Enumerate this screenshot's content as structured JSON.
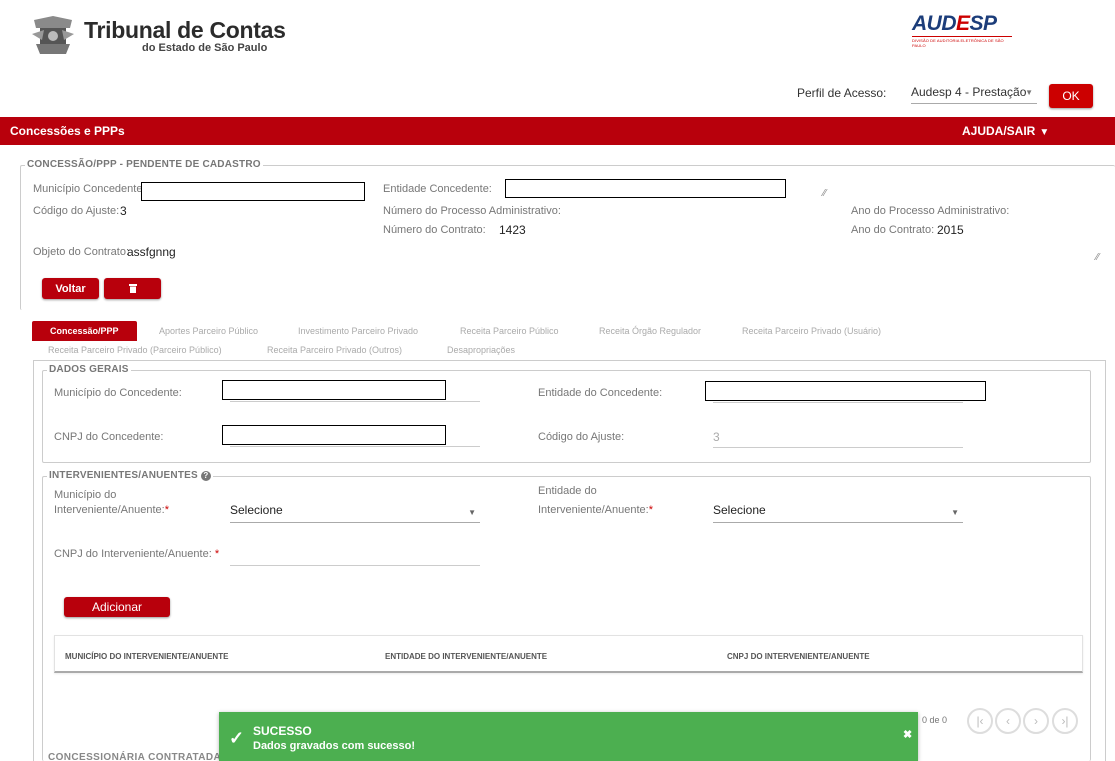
{
  "header": {
    "logo_title": "Tribunal de Contas",
    "logo_subtitle": "do Estado de São Paulo",
    "audesp_title_a": "AUD",
    "audesp_title_e": "E",
    "audesp_title_b": "SP",
    "audesp_subtitle": "DIVISÃO DE AUDITORIA ELETRÔNICA DE SÃO PAULO",
    "perfil_label": "Perfil de Acesso:",
    "perfil_value": "Audesp 4 - Prestação",
    "ok_label": "OK"
  },
  "navbar": {
    "title": "Concessões e PPPs",
    "help": "AJUDA/SAIR"
  },
  "pending": {
    "legend": "CONCESSÃO/PPP - PENDENTE DE CADASTRO",
    "municipio_label": "Município Concedente:",
    "entidade_label": "Entidade Concedente:",
    "codigo_label": "Código do Ajuste:",
    "codigo_value": "3",
    "num_processo_label": "Número do Processo Administrativo:",
    "ano_processo_label": "Ano do Processo Administrativo:",
    "num_contrato_label": "Número do Contrato:",
    "num_contrato_value": "1423",
    "ano_contrato_label": "Ano do Contrato:",
    "ano_contrato_value": "2015",
    "objeto_label": "Objeto do Contrato:",
    "objeto_value": "assfgnng",
    "voltar_label": "Voltar",
    "delete_icon": "trash-icon"
  },
  "tabs": [
    "Concessão/PPP",
    "Aportes Parceiro Público",
    "Investimento Parceiro Privado",
    "Receita Parceiro Público",
    "Receita Órgão Regulador",
    "Receita Parceiro Privado (Usuário)",
    "Receita Parceiro Privado (Parceiro Público)",
    "Receita Parceiro Privado (Outros)",
    "Desapropriações"
  ],
  "dados_gerais": {
    "legend": "DADOS GERAIS",
    "municipio_label": "Município do Concedente:",
    "entidade_label": "Entidade do Concedente:",
    "cnpj_label": "CNPJ do Concedente:",
    "codigo_label": "Código do Ajuste:",
    "codigo_value": "3"
  },
  "intervenientes": {
    "legend": "INTERVENIENTES/ANUENTES",
    "help_icon": "question-icon",
    "municipio_label_1": "Município do",
    "municipio_label_2": "Interveniente/Anuente:",
    "municipio_value": "Selecione",
    "entidade_label_1": "Entidade do",
    "entidade_label_2": "Interveniente/Anuente:",
    "entidade_value": "Selecione",
    "required_mark": "*",
    "cnpj_label": "CNPJ do Interveniente/Anuente:",
    "adicionar_label": "Adicionar",
    "columns": [
      "MUNICÍPIO DO INTERVENIENTE/ANUENTE",
      "ENTIDADE DO INTERVENIENTE/ANUENTE",
      "CNPJ DO INTERVENIENTE/ANUENTE"
    ],
    "pager_count": "0 de 0"
  },
  "toast": {
    "title": "SUCESSO",
    "message": "Dados gravados com sucesso!"
  },
  "bottom_legend": "CONCESSIONÁRIA CONTRATADA / P"
}
